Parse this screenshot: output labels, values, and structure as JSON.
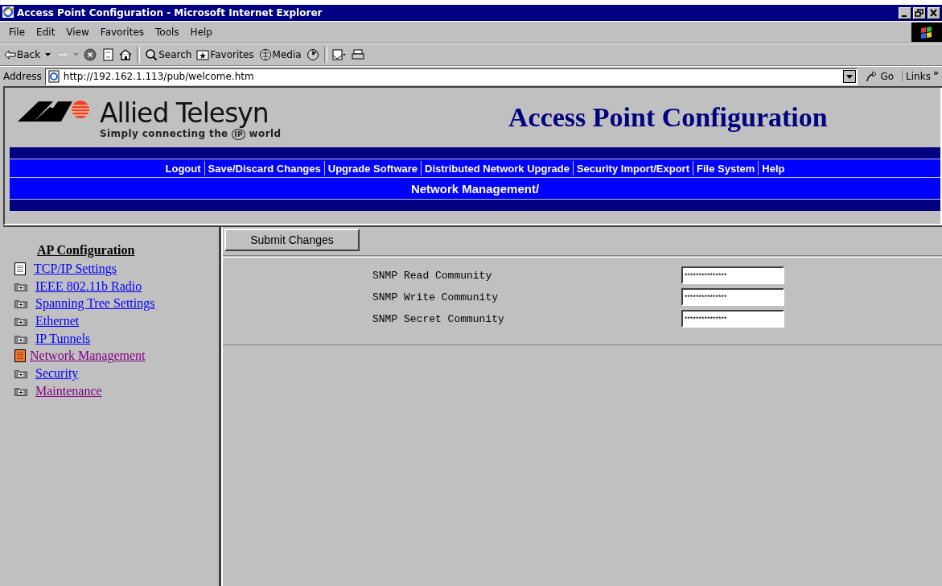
{
  "window": {
    "title": "Access Point Configuration - Microsoft Internet Explorer"
  },
  "menu": [
    "File",
    "Edit",
    "View",
    "Favorites",
    "Tools",
    "Help"
  ],
  "toolbar": [
    {
      "kind": "back",
      "label": "Back",
      "disabled": false
    },
    {
      "kind": "forward",
      "disabled": true
    },
    {
      "kind": "stop",
      "disabled": false
    },
    {
      "kind": "refresh",
      "disabled": false
    },
    {
      "kind": "home",
      "disabled": false
    },
    {
      "kind": "search",
      "label": "Search",
      "disabled": false
    },
    {
      "kind": "favorites",
      "label": "Favorites",
      "disabled": false
    },
    {
      "kind": "media",
      "label": "Media",
      "disabled": false
    },
    {
      "kind": "history",
      "disabled": false
    },
    {
      "kind": "mail",
      "disabled": false
    },
    {
      "kind": "print",
      "disabled": false
    }
  ],
  "address_bar": {
    "label": "Address",
    "value": "http://192.162.1.113/pub/welcome.htm",
    "go": "Go",
    "links": "Links",
    "more": "»"
  },
  "header": {
    "brand": "Allied Telesyn",
    "tagline_before": "Simply connecting the",
    "tagline_mark": "IP",
    "tagline_after": "world",
    "title": "Access Point Configuration"
  },
  "nav": [
    "Logout",
    "Save/Discard Changes",
    "Upgrade Software",
    "Distributed Network Upgrade",
    "Security Import/Export",
    "File System",
    "Help"
  ],
  "breadcrumb": "Network Management/",
  "sidebar": {
    "title": "AP Configuration",
    "items": [
      {
        "label": "TCP/IP Settings",
        "kind": "page",
        "selected": false,
        "visited": false
      },
      {
        "label": "IEEE 802.11b Radio",
        "kind": "folder",
        "selected": false,
        "visited": false
      },
      {
        "label": "Spanning Tree Settings",
        "kind": "folder",
        "selected": false,
        "visited": false
      },
      {
        "label": "Ethernet",
        "kind": "folder",
        "selected": false,
        "visited": false
      },
      {
        "label": "IP Tunnels",
        "kind": "folder",
        "selected": false,
        "visited": false
      },
      {
        "label": "Network Management",
        "kind": "page",
        "selected": true,
        "visited": true
      },
      {
        "label": "Security",
        "kind": "folder",
        "selected": false,
        "visited": false
      },
      {
        "label": "Maintenance",
        "kind": "folder",
        "selected": false,
        "visited": true
      }
    ]
  },
  "submit": "Submit Changes",
  "fields": [
    {
      "label": "SNMP Read Community",
      "value": "***************"
    },
    {
      "label": "SNMP Write Community",
      "value": "***************"
    },
    {
      "label": "SNMP Secret Community",
      "value": "***************"
    }
  ]
}
